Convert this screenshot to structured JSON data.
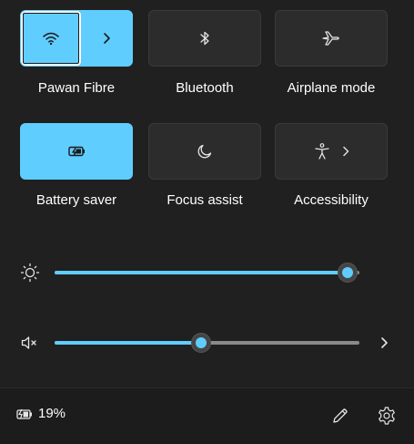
{
  "tiles": {
    "wifi": {
      "label": "Pawan Fibre",
      "icon": "wifi-icon",
      "active": true
    },
    "bluetooth": {
      "label": "Bluetooth",
      "icon": "bluetooth-icon",
      "active": false
    },
    "airplane": {
      "label": "Airplane mode",
      "icon": "airplane-icon",
      "active": false
    },
    "battery_saver": {
      "label": "Battery saver",
      "icon": "battery-saver-icon",
      "active": true
    },
    "focus_assist": {
      "label": "Focus assist",
      "icon": "moon-icon",
      "active": false
    },
    "accessibility": {
      "label": "Accessibility",
      "icon": "accessibility-icon",
      "active": false
    }
  },
  "sliders": {
    "brightness": {
      "icon": "brightness-icon",
      "value": 0.96
    },
    "volume": {
      "icon": "speaker-muted-icon",
      "value": 0.48
    }
  },
  "footer": {
    "battery_percent": "19%",
    "battery_icon": "battery-charging-icon",
    "edit_icon": "pencil-icon",
    "settings_icon": "gear-icon"
  },
  "colors": {
    "accent": "#60cdff",
    "panel_bg": "#202020",
    "tile_bg": "#2c2c2c",
    "footer_bg": "#1c1c1c",
    "track": "#8a8a8a"
  }
}
